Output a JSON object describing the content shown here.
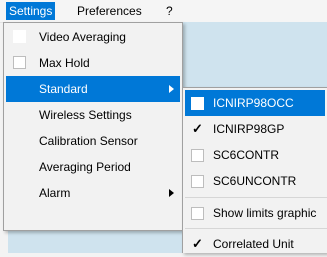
{
  "menubar": {
    "items": [
      {
        "label": "Settings"
      },
      {
        "label": "Preferences"
      },
      {
        "label": "?"
      }
    ]
  },
  "settings_menu": {
    "items": [
      {
        "label": "Video Averaging"
      },
      {
        "label": "Max Hold"
      },
      {
        "label": "Standard"
      },
      {
        "label": "Wireless Settings"
      },
      {
        "label": "Calibration Sensor"
      },
      {
        "label": "Averaging Period"
      },
      {
        "label": "Alarm"
      }
    ]
  },
  "standard_submenu": {
    "items": [
      {
        "label": "ICNIRP98OCC",
        "checked": false
      },
      {
        "label": "ICNIRP98GP",
        "checked": true
      },
      {
        "label": "SC6CONTR",
        "checked": false
      },
      {
        "label": "SC6UNCONTR",
        "checked": false
      },
      {
        "label": "Show limits graphic",
        "checked": false
      },
      {
        "label": "Correlated Unit",
        "checked": true
      }
    ]
  },
  "colors": {
    "highlight": "#0078d7",
    "menu_background": "#f2f2f2",
    "panel_background": "#cfe3ee"
  }
}
